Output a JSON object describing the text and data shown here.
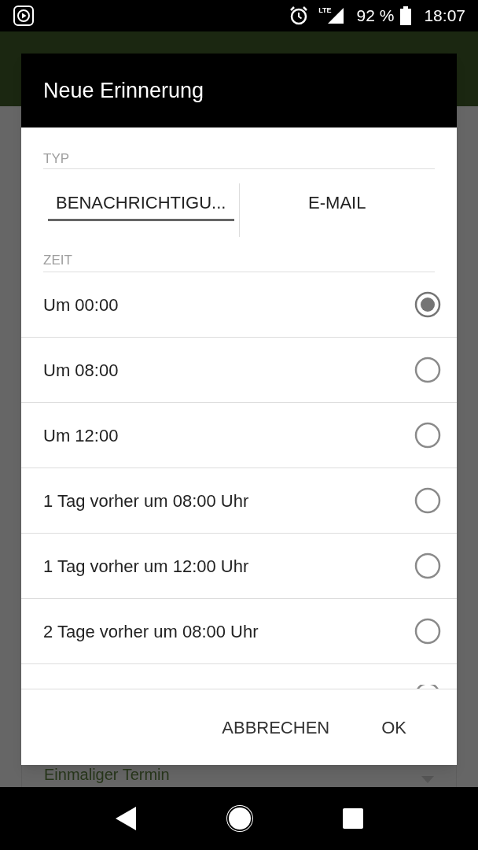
{
  "status_bar": {
    "battery": "92 %",
    "time": "18:07",
    "network": "LTE"
  },
  "dialog": {
    "title": "Neue Erinnerung",
    "type_section": {
      "label": "TYP",
      "tabs": [
        {
          "label": "BENACHRICHTIGU...",
          "selected": true
        },
        {
          "label": "E-MAIL",
          "selected": false
        }
      ]
    },
    "time_section": {
      "label": "ZEIT",
      "options": [
        {
          "label": "Um 00:00",
          "selected": true
        },
        {
          "label": "Um 08:00",
          "selected": false
        },
        {
          "label": "Um 12:00",
          "selected": false
        },
        {
          "label": "1 Tag vorher um 08:00 Uhr",
          "selected": false
        },
        {
          "label": "1 Tag vorher um 12:00 Uhr",
          "selected": false
        },
        {
          "label": "2 Tage vorher um 08:00 Uhr",
          "selected": false
        }
      ],
      "cut_off_option": {
        "selected": false
      }
    },
    "buttons": [
      "ABBRECHEN",
      "OK"
    ]
  },
  "background": {
    "field_value": "Einmaliger Termin"
  }
}
